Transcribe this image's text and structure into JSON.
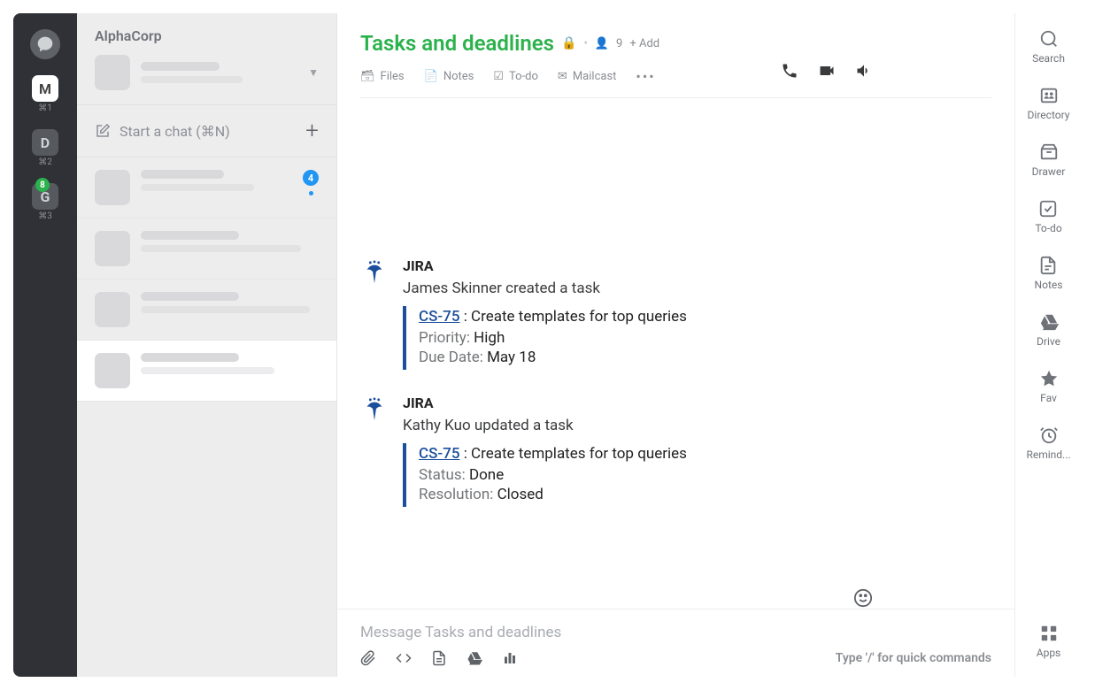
{
  "rail": {
    "items": [
      {
        "letter": "M",
        "sub": "⌘1",
        "style": "white"
      },
      {
        "letter": "D",
        "sub": "⌘2",
        "style": "gray"
      },
      {
        "letter": "G",
        "sub": "⌘3",
        "style": "gray",
        "badge": "8"
      }
    ]
  },
  "sidebar": {
    "workspace": "AlphaCorp",
    "start_chat": "Start a chat (⌘N)",
    "chats": [
      {
        "badge": "4"
      },
      {},
      {},
      {
        "active": true
      }
    ]
  },
  "channel": {
    "title": "Tasks and deadlines",
    "member_count": "9",
    "add_label": "+ Add"
  },
  "tabs": {
    "files": "Files",
    "notes": "Notes",
    "todo": "To-do",
    "mailcast": "Mailcast"
  },
  "messages": [
    {
      "sender": "JIRA",
      "action": "James Skinner created a task",
      "link": "CS-75",
      "link_suffix": " : Create templates for top queries",
      "rows": [
        {
          "label": "Priority:",
          "value": "High"
        },
        {
          "label": "Due Date:",
          "value": "May 18"
        }
      ]
    },
    {
      "sender": "JIRA",
      "action": "Kathy Kuo updated a task",
      "link": "CS-75",
      "link_suffix": " : Create templates for top queries",
      "rows": [
        {
          "label": "Status:",
          "value": "Done"
        },
        {
          "label": "Resolution:",
          "value": "Closed"
        }
      ]
    }
  ],
  "composer": {
    "placeholder": "Message Tasks and deadlines",
    "hint": "Type '/' for quick commands"
  },
  "rrail": {
    "search": "Search",
    "directory": "Directory",
    "drawer": "Drawer",
    "todo": "To-do",
    "notes": "Notes",
    "drive": "Drive",
    "fav": "Fav",
    "remind": "Remind...",
    "apps": "Apps"
  }
}
